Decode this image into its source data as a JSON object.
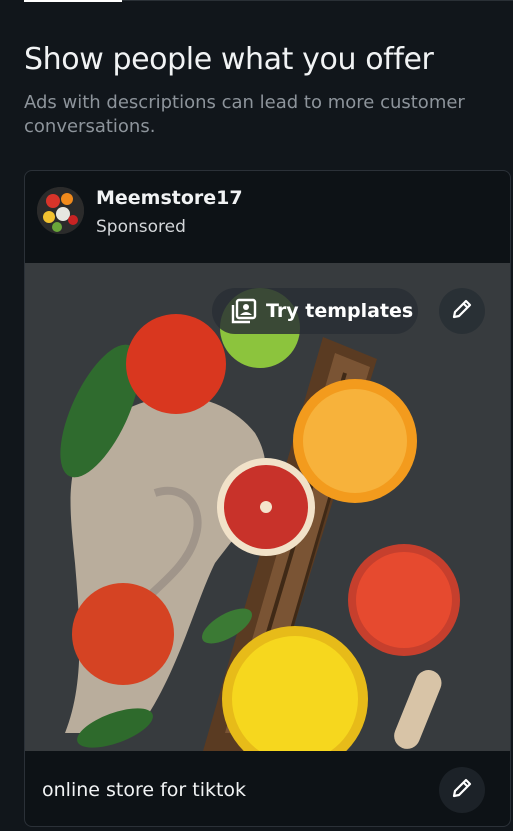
{
  "header": {
    "title": "Show people what you offer",
    "subtitle": "Ads with descriptions can lead to more customer conversations."
  },
  "ad_preview": {
    "account_name": "Meemstore17",
    "sponsored_label": "Sponsored",
    "templates_button_label": "Try templates",
    "description": "online store for tiktok",
    "icons": {
      "templates": "templates-icon",
      "edit": "pencil-icon"
    }
  },
  "colors": {
    "background": "#11161b",
    "card_border": "#2b3138",
    "button_bg": "#282e34",
    "text_primary": "#f1f3f4",
    "text_secondary": "#8d949b"
  }
}
